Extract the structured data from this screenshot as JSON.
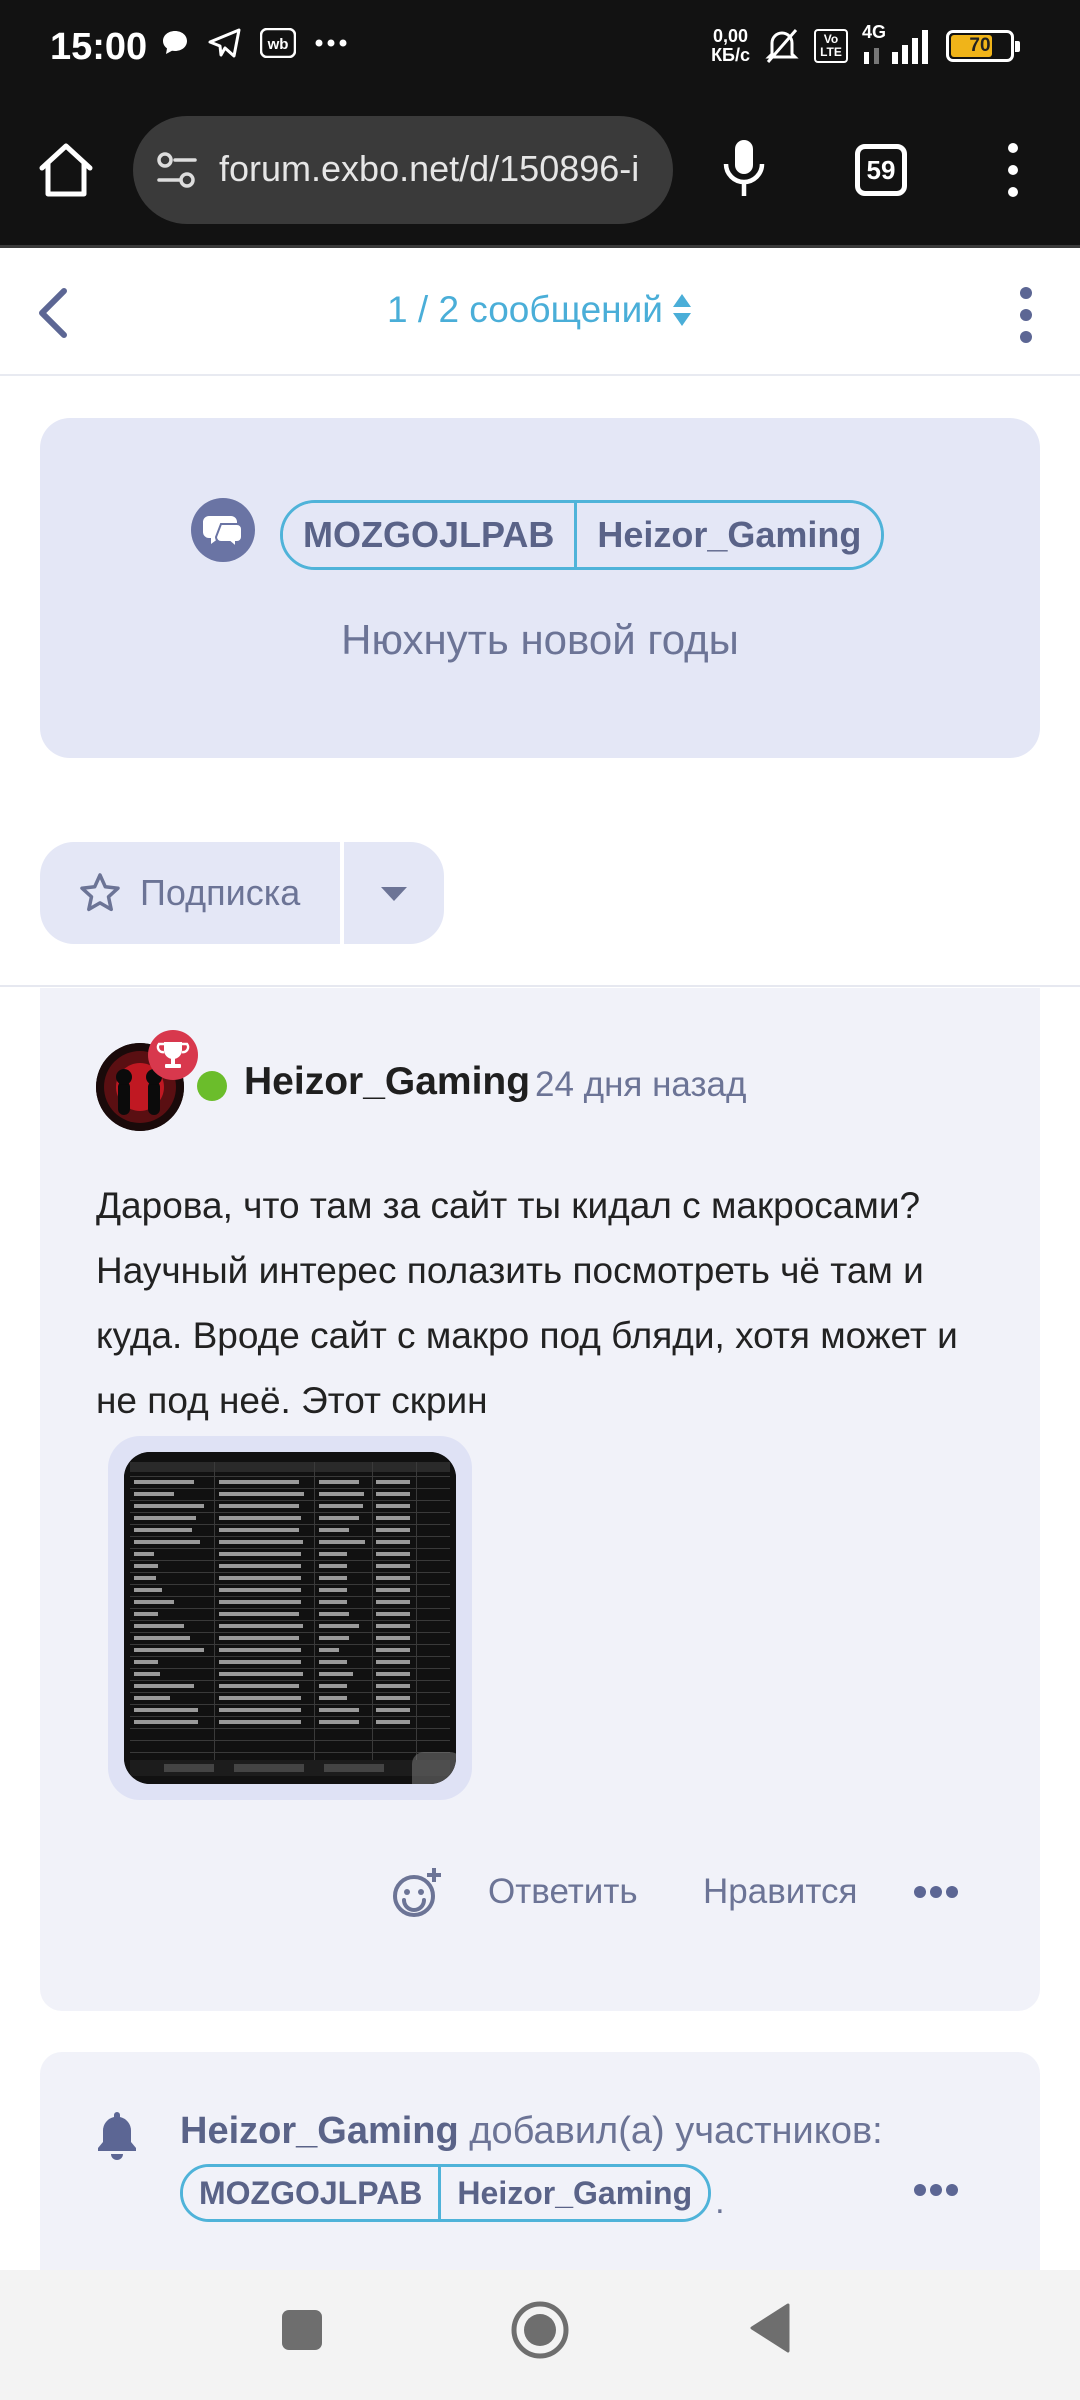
{
  "status_bar": {
    "time": "15:00",
    "net_speed_value": "0,00",
    "net_speed_unit": "КБ/с",
    "volte": "Vo LTE",
    "network": "4G",
    "battery": "70"
  },
  "browser": {
    "url": "forum.exbo.net/d/150896-i",
    "tab_count": "59"
  },
  "forum_header": {
    "scrubber_label": "1 / 2 сообщений"
  },
  "discussion": {
    "tags": [
      "MOZGOJLPAB",
      "Heizor_Gaming"
    ],
    "title": "Нюхнуть новой годы",
    "subscribe_label": "Подписка"
  },
  "post": {
    "username": "Heizor_Gaming",
    "time": "24 дня назад",
    "body": "Дарова, что там за сайт ты кидал с макросами? Научный интерес полазить посмотреть чё там и куда. Вроде сайт с макро под бляди, хотя может и не под неё. Этот скрин",
    "reply_label": "Ответить",
    "like_label": "Нравится"
  },
  "event": {
    "username": "Heizor_Gaming",
    "action": "добавил(а) участников:",
    "tags": [
      "MOZGOJLPAB",
      "Heizor_Gaming"
    ],
    "trailing": "."
  },
  "colors": {
    "accent": "#4fb3d9",
    "hero_bg": "#e4e7f6",
    "post_bg": "#f1f2f9",
    "muted_text": "#6c7496",
    "online": "#6bbd2b",
    "badge": "#d8384d"
  },
  "icons": {
    "home": "home-icon",
    "site_settings": "site-settings-icon",
    "mic": "microphone-icon",
    "menu": "more-vertical-icon",
    "back": "chevron-left-icon",
    "chat": "chat-bubbles-icon",
    "star": "star-icon",
    "caret": "caret-down-icon",
    "trophy": "trophy-icon",
    "react": "add-reaction-icon",
    "more": "more-horizontal-icon",
    "bell": "bell-icon"
  }
}
